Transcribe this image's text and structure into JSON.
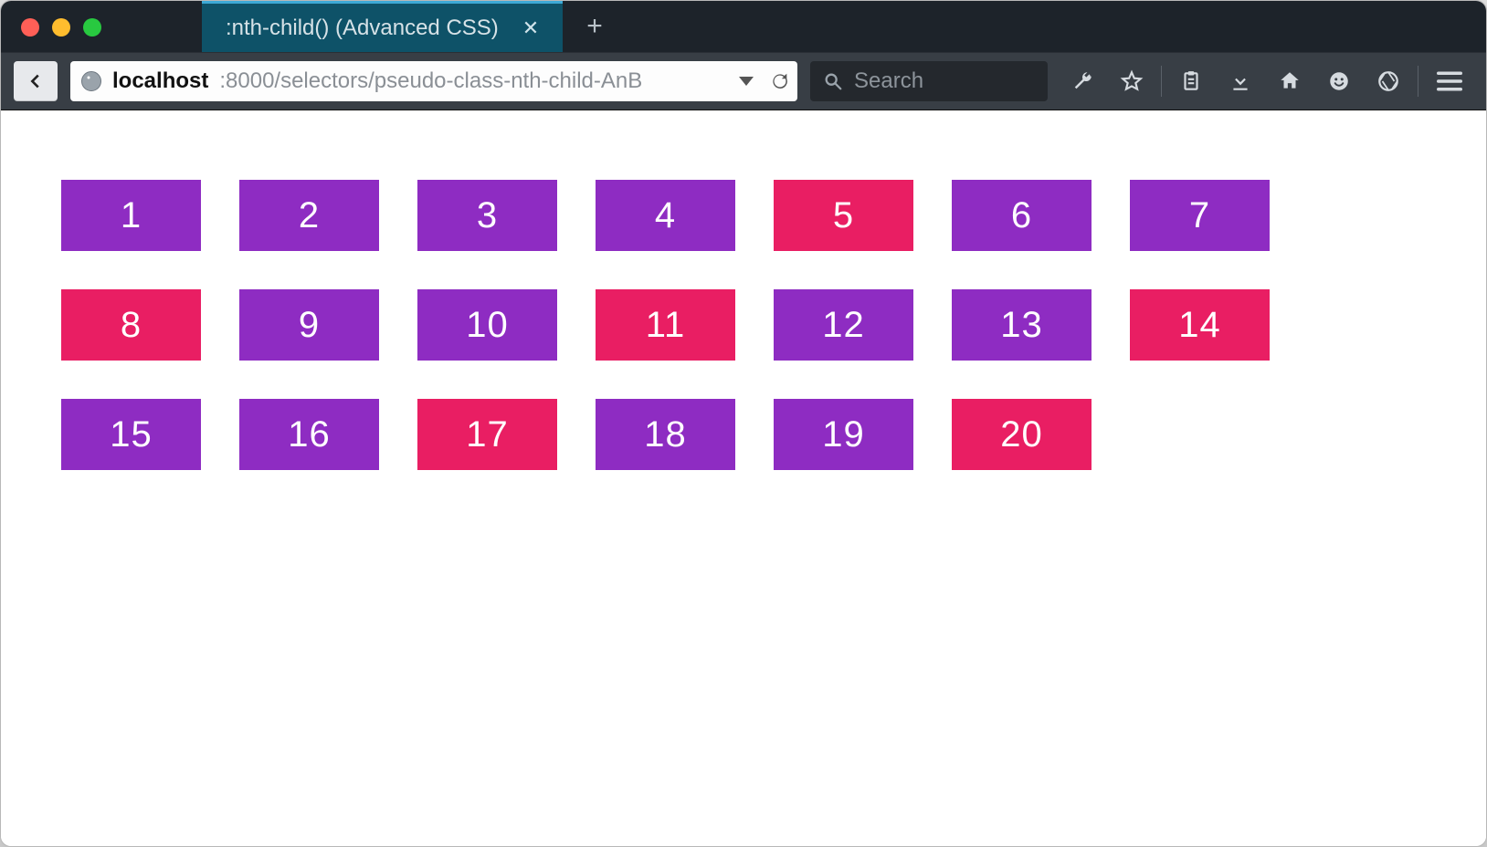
{
  "tab": {
    "title": ":nth-child() (Advanced CSS)"
  },
  "url": {
    "host": "localhost",
    "path": ":8000/selectors/pseudo-class-nth-child-AnB"
  },
  "search": {
    "placeholder": "Search"
  },
  "colors": {
    "default": "#8e2cc2",
    "highlight": "#e91e63"
  },
  "grid": {
    "columns": 7,
    "cells": [
      {
        "n": "1",
        "hi": false
      },
      {
        "n": "2",
        "hi": false
      },
      {
        "n": "3",
        "hi": false
      },
      {
        "n": "4",
        "hi": false
      },
      {
        "n": "5",
        "hi": true
      },
      {
        "n": "6",
        "hi": false
      },
      {
        "n": "7",
        "hi": false
      },
      {
        "n": "8",
        "hi": true
      },
      {
        "n": "9",
        "hi": false
      },
      {
        "n": "10",
        "hi": false
      },
      {
        "n": "11",
        "hi": true
      },
      {
        "n": "12",
        "hi": false
      },
      {
        "n": "13",
        "hi": false
      },
      {
        "n": "14",
        "hi": true
      },
      {
        "n": "15",
        "hi": false
      },
      {
        "n": "16",
        "hi": false
      },
      {
        "n": "17",
        "hi": true
      },
      {
        "n": "18",
        "hi": false
      },
      {
        "n": "19",
        "hi": false
      },
      {
        "n": "20",
        "hi": true
      }
    ]
  }
}
